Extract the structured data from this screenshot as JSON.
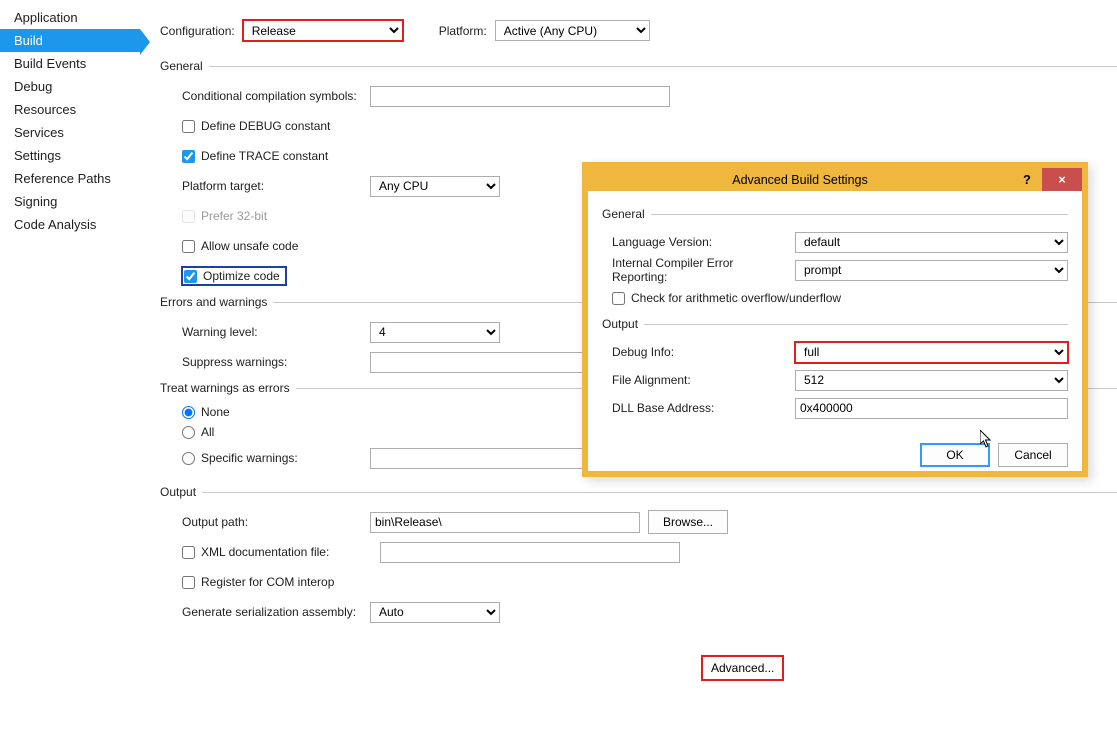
{
  "sidebar": {
    "items": [
      {
        "label": "Application"
      },
      {
        "label": "Build"
      },
      {
        "label": "Build Events"
      },
      {
        "label": "Debug"
      },
      {
        "label": "Resources"
      },
      {
        "label": "Services"
      },
      {
        "label": "Settings"
      },
      {
        "label": "Reference Paths"
      },
      {
        "label": "Signing"
      },
      {
        "label": "Code Analysis"
      }
    ],
    "selected_index": 1
  },
  "top": {
    "config_label": "Configuration:",
    "config_value": "Release",
    "platform_label": "Platform:",
    "platform_value": "Active (Any CPU)"
  },
  "general": {
    "header": "General",
    "cond_sym_label": "Conditional compilation symbols:",
    "cond_sym_value": "",
    "define_debug": "Define DEBUG constant",
    "define_trace": "Define TRACE constant",
    "platform_target_label": "Platform target:",
    "platform_target_value": "Any CPU",
    "prefer32": "Prefer 32-bit",
    "allow_unsafe": "Allow unsafe code",
    "optimize": "Optimize code"
  },
  "errors": {
    "header": "Errors and warnings",
    "warning_level_label": "Warning level:",
    "warning_level_value": "4",
    "suppress_label": "Suppress warnings:",
    "suppress_value": ""
  },
  "treat": {
    "header": "Treat warnings as errors",
    "none": "None",
    "all": "All",
    "specific": "Specific warnings:"
  },
  "output": {
    "header": "Output",
    "path_label": "Output path:",
    "path_value": "bin\\Release\\",
    "browse": "Browse...",
    "xml_doc": "XML documentation file:",
    "com_interop": "Register for COM interop",
    "gen_serial_label": "Generate serialization assembly:",
    "gen_serial_value": "Auto",
    "advanced": "Advanced..."
  },
  "dialog": {
    "title": "Advanced Build Settings",
    "general_header": "General",
    "lang_version_label": "Language Version:",
    "lang_version_value": "default",
    "internal_err_label": "Internal Compiler Error Reporting:",
    "internal_err_value": "prompt",
    "arith_check": "Check for arithmetic overflow/underflow",
    "output_header": "Output",
    "debug_info_label": "Debug Info:",
    "debug_info_value": "full",
    "file_align_label": "File Alignment:",
    "file_align_value": "512",
    "dll_base_label": "DLL Base Address:",
    "dll_base_value": "0x400000",
    "ok": "OK",
    "cancel": "Cancel"
  }
}
